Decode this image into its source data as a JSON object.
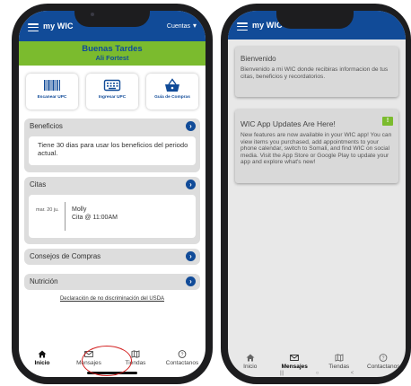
{
  "left_screen": {
    "header": {
      "title": "my WIC",
      "accounts_label": "Cuentas"
    },
    "greeting": {
      "line1": "Buenas Tardes",
      "line2": "Ali Fortest"
    },
    "tiles": [
      {
        "label": "Escanear UPC",
        "icon": "barcode-icon"
      },
      {
        "label": "Ingresar UPC",
        "icon": "keyboard-icon"
      },
      {
        "label": "Guía de Compras",
        "icon": "basket-icon"
      }
    ],
    "benefits": {
      "title": "Beneficios",
      "message": "Tiene 30 dias para usar los beneficios del periodo actual."
    },
    "appointments": {
      "title": "Citas",
      "date": "mar. 20 ju.",
      "name": "Molly",
      "time": "Cita @ 11:00AM"
    },
    "shopping_tips": {
      "title": "Consejos de Compras"
    },
    "nutrition": {
      "title": "Nutrición"
    },
    "usda_link": "Declaración de no discriminación del USDA",
    "bottom_nav": [
      {
        "label": "Inicio",
        "icon": "home-icon",
        "active": true
      },
      {
        "label": "Mensajes",
        "icon": "envelope-icon",
        "active": false
      },
      {
        "label": "Tiendas",
        "icon": "map-icon",
        "active": false
      },
      {
        "label": "Contactanos",
        "icon": "help-icon",
        "active": false
      }
    ]
  },
  "right_screen": {
    "header": {
      "title": "my WIC"
    },
    "cards": [
      {
        "title": "Bienvenido",
        "body": "Bienvenido a mi WIC donde recibiras informacion de tus citas, beneficios y recordatorios."
      },
      {
        "title": "WIC App Updates Are Here!",
        "badge": "!",
        "body": "New features are now available in your WIC app! You can view items you purchased, add appointments to your phone calendar, switch to Somali, and find WIC on social media. Visit the App Store or Google Play to update your app and explore what's new!"
      }
    ],
    "bottom_nav": [
      {
        "label": "Inicio",
        "icon": "home-icon",
        "active": false
      },
      {
        "label": "Mensajes",
        "icon": "envelope-icon",
        "active": true
      },
      {
        "label": "Tiendas",
        "icon": "map-icon",
        "active": false
      },
      {
        "label": "Contactanos",
        "icon": "help-icon",
        "active": false
      }
    ],
    "system_nav": [
      "|||",
      "○",
      "<"
    ]
  },
  "colors": {
    "brand_blue": "#114b98",
    "brand_green": "#7bbb2e",
    "highlight_red": "#d32020"
  }
}
